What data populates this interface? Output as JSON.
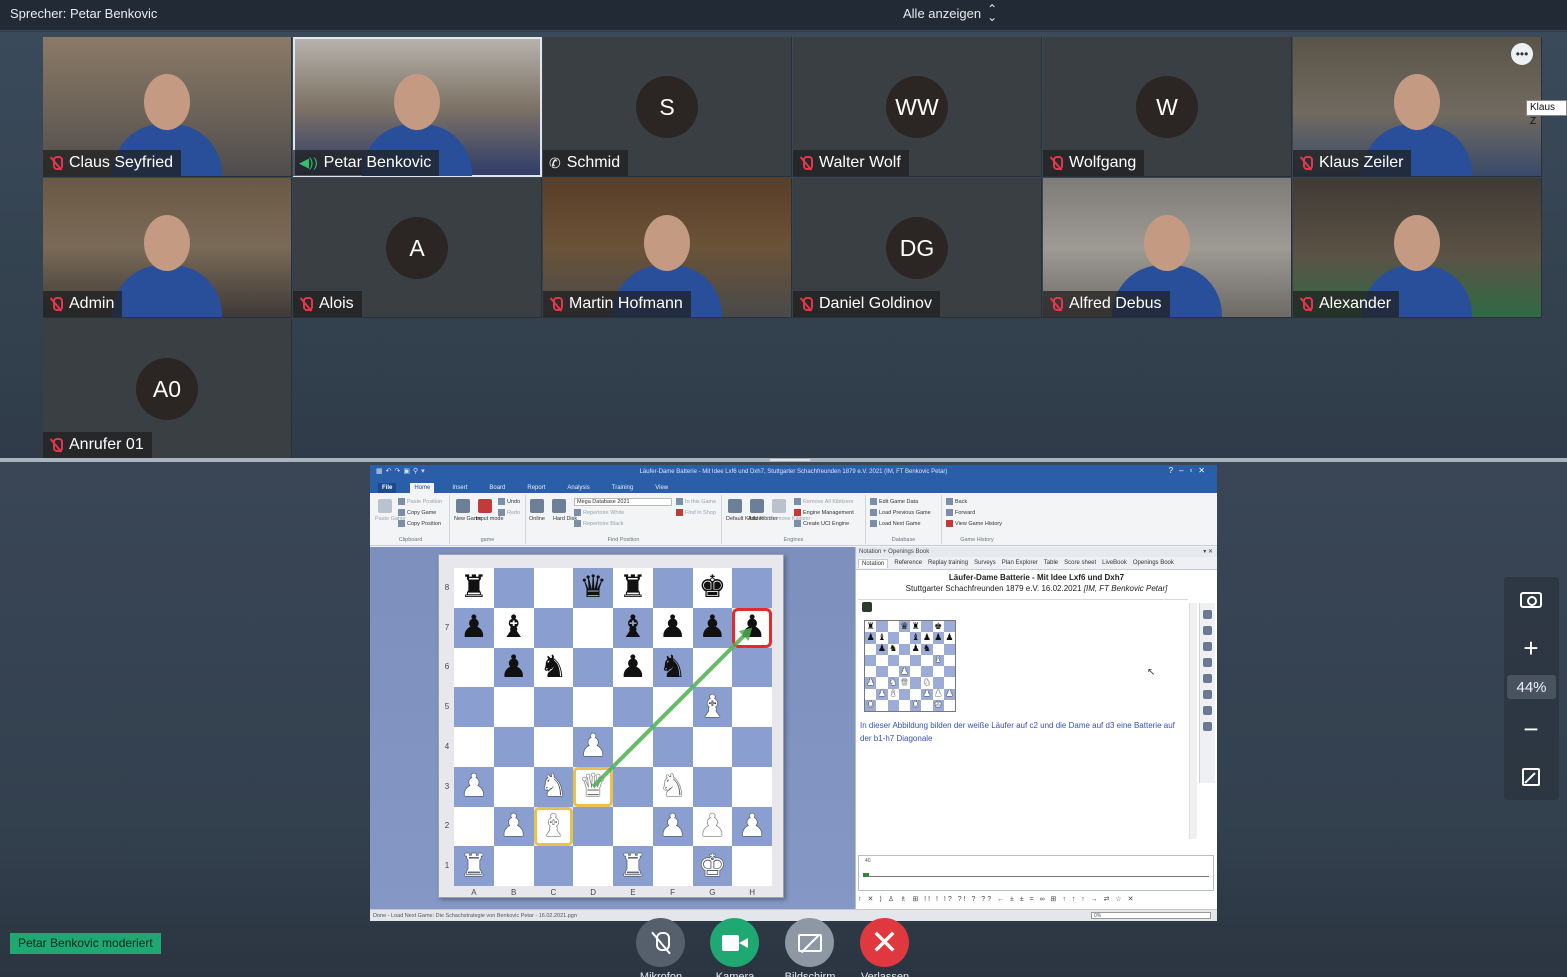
{
  "topbar": {
    "speaker": "Sprecher: Petar Benkovic",
    "view_mode": "Alle anzeigen"
  },
  "participants": [
    {
      "name": "Claus Seyfried",
      "status": "muted",
      "video": true,
      "style": "v1"
    },
    {
      "name": "Petar Benkovic",
      "status": "speaking",
      "video": true,
      "style": "v2",
      "active": true
    },
    {
      "name": "Schmid",
      "status": "phone",
      "video": false,
      "initials": "S"
    },
    {
      "name": "Walter Wolf",
      "status": "muted",
      "video": false,
      "initials": "WW"
    },
    {
      "name": "Wolfgang",
      "status": "muted",
      "video": false,
      "initials": "W"
    },
    {
      "name": "Klaus Zeiler",
      "status": "muted",
      "video": true,
      "style": "v4",
      "menu": true
    },
    {
      "name": "Admin",
      "status": "muted",
      "video": true,
      "style": "v3"
    },
    {
      "name": "Alois",
      "status": "muted",
      "video": false,
      "initials": "A"
    },
    {
      "name": "Martin Hofmann",
      "status": "muted",
      "video": true,
      "style": "v7"
    },
    {
      "name": "Daniel Goldinov",
      "status": "muted",
      "video": false,
      "initials": "DG"
    },
    {
      "name": "Alfred Debus",
      "status": "muted",
      "video": true,
      "style": "v5"
    },
    {
      "name": "Alexander",
      "status": "muted",
      "video": true,
      "style": "v6"
    },
    {
      "name": "Anrufer 01",
      "status": "muted",
      "video": false,
      "initials": "A0"
    }
  ],
  "tooltip": "Klaus Z",
  "chessbase": {
    "title": "Läufer-Dame Batterie - Mit Idee Lxf6 und Dxh7, Stuttgarter Schachfreunden 1879 e.V. 2021 (IM, FT Benkovic Petar)",
    "tabs": [
      "File",
      "Home",
      "Insert",
      "Board",
      "Report",
      "Analysis",
      "Training",
      "View"
    ],
    "selected_tab": "Home",
    "ribbon": {
      "clipboard": {
        "label": "Clipboard",
        "paste": "Paste Game",
        "paste_position": "Paste Position",
        "copy_game": "Copy Game",
        "copy_position": "Copy Position"
      },
      "game": {
        "label": "game",
        "new_game": "New Game",
        "input_mode": "Input mode",
        "undo": "Undo",
        "redo": "Redo"
      },
      "find": {
        "label": "Find Position",
        "online": "Online",
        "hard_disk": "Hard Disk",
        "database": "Mega Database 2021",
        "rep_white": "Repertoire White",
        "rep_black": "Repertoire Black",
        "in_game": "In this Game",
        "in_shop": "Find in Shop"
      },
      "engines": {
        "label": "Engines",
        "default": "Default Kibitzer",
        "add": "Add Kibitzer",
        "remove": "Remove Kibitzer",
        "remove_all": "Remove All Kibitzers",
        "management": "Engine Management",
        "create_uci": "Create UCI Engine"
      },
      "database": {
        "label": "Database",
        "edit": "Edit Game Data",
        "load_prev": "Load Previous Game",
        "load_next": "Load Next Game"
      },
      "history": {
        "label": "Game History",
        "back": "Back",
        "forward": "Forward",
        "view": "View Game History"
      }
    },
    "board": {
      "ranks": [
        "8",
        "7",
        "6",
        "5",
        "4",
        "3",
        "2",
        "1"
      ],
      "files": [
        "A",
        "B",
        "C",
        "D",
        "E",
        "F",
        "G",
        "H"
      ],
      "position": [
        [
          "bR",
          "",
          "",
          "bQ",
          "bR",
          "",
          "bK",
          ""
        ],
        [
          "bP",
          "bB",
          "",
          "",
          "bB",
          "bP",
          "bP",
          "bP"
        ],
        [
          "",
          "bP",
          "bN",
          "",
          "bP",
          "bN",
          "",
          ""
        ],
        [
          "",
          "",
          "",
          "",
          "",
          "",
          "wB",
          ""
        ],
        [
          "",
          "",
          "",
          "wP",
          "",
          "",
          "",
          ""
        ],
        [
          "wP",
          "",
          "wN",
          "wQ",
          "",
          "wN",
          "",
          ""
        ],
        [
          "",
          "wP",
          "wB",
          "",
          "",
          "wP",
          "wP",
          "wP"
        ],
        [
          "wR",
          "",
          "",
          "",
          "wR",
          "",
          "wK",
          ""
        ]
      ],
      "highlights_yellow": [
        "c2",
        "d3"
      ],
      "highlight_red": "h7",
      "arrow": {
        "from": "d3",
        "to": "h7",
        "color": "#4caf50"
      }
    },
    "notation": {
      "header": "Notation + Openings Book",
      "tabs": [
        "Notation",
        "Reference",
        "Replay training",
        "Surveys",
        "Plan Explorer",
        "Table",
        "Score sheet",
        "LiveBook",
        "Openings Book"
      ],
      "selected_tab": "Notation",
      "title": "Läufer-Dame Batterie - Mit Idee Lxf6 und Dxh7",
      "subtitle": "Stuttgarter Schachfreunden 1879 e.V. 16.02.2021",
      "subtitle_italic": "[IM, FT Benkovic Petar]",
      "comment": "In dieser Abbildung bilden der weiße Läufer auf c2 und die Dame auf d3 eine Batterie auf der b1-h7 Diagonale",
      "bottom_symbols": "↑ ✕ ⟩ ♙ ♗ ⊞ !! ! !? ?! ? ?? ← ± ± = ∞ ⊞ ↑ ↑ ↑ → ⇄ ☆ ✕",
      "graph_label": "40"
    },
    "status": "Done - Load Next Game: Die Schachstrategie von Benkovic Petar - 16.02.2021.pgn",
    "progress": "0%"
  },
  "zoom": {
    "value": "44%"
  },
  "moderator_badge": "Petar Benkovic moderiert",
  "controls": {
    "mic": "Mikrofon",
    "cam": "Kamera",
    "share": "Bildschirm",
    "leave": "Verlassen"
  },
  "colors": {
    "accent_green": "#1fa871",
    "leave_red": "#e0383f",
    "muted_red": "#e2374a",
    "speaking_green": "#35c06f"
  }
}
